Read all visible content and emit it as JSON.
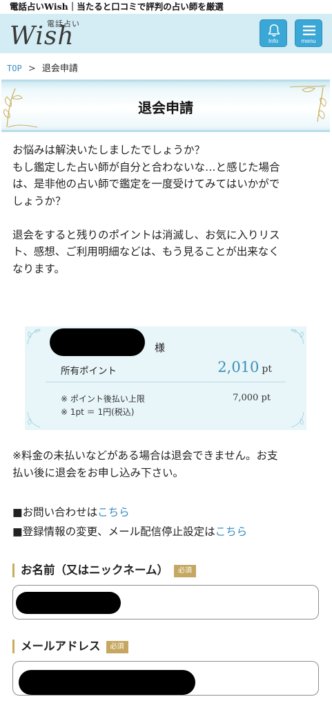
{
  "site_tagline": "電話占いWish｜当たると口コミで評判の占い師を厳選",
  "header": {
    "logo_small": "電話占い",
    "logo_main": "Wish",
    "info_label": "Info",
    "menu_label": "menu"
  },
  "breadcrumb": {
    "top": "TOP",
    "separator": ">",
    "current": "退会申請"
  },
  "page_title": "退会申請",
  "intro": {
    "p1_line1": "お悩みは解決いたしましたでしょうか？",
    "p1_line2": "もし鑑定した占い師が自分と合わないな…と感じた場合",
    "p1_line3": "は、是非他の占い師で鑑定を一度受けてみてはいかがで",
    "p1_line4": "しょうか？",
    "p2_line1": "退会をすると残りのポイントは消滅し、お気に入りリス",
    "p2_line2": "ト、感想、ご利用明細などは、もう見ることが出来なく",
    "p2_line3": "なります。"
  },
  "points": {
    "honorific": "様",
    "owned_label": "所有ポイント",
    "owned_value": "2,010",
    "owned_unit": "pt",
    "note_limit": "※ ポイント後払い上限",
    "note_rate": "※ 1pt ＝ 1円(税込)",
    "limit_value": "7,000 pt"
  },
  "warning": {
    "line1": "※料金の未払いなどがある場合は退会できません。お支",
    "line2": "払い後に退会をお申し込み下さい。"
  },
  "links": {
    "contact_prefix": "■お問い合わせは",
    "contact_link": "こちら",
    "settings_prefix": "■登録情報の変更、メール配信停止設定は",
    "settings_link": "こちら"
  },
  "form": {
    "name_label": "お名前（又はニックネーム）",
    "email_label": "メールアドレス",
    "required_badge": "必須"
  },
  "colors": {
    "accent_blue": "#3aa7d6",
    "link_blue": "#3a8fc0",
    "gold": "#c5a761",
    "header_bg": "#d4ecf4"
  }
}
